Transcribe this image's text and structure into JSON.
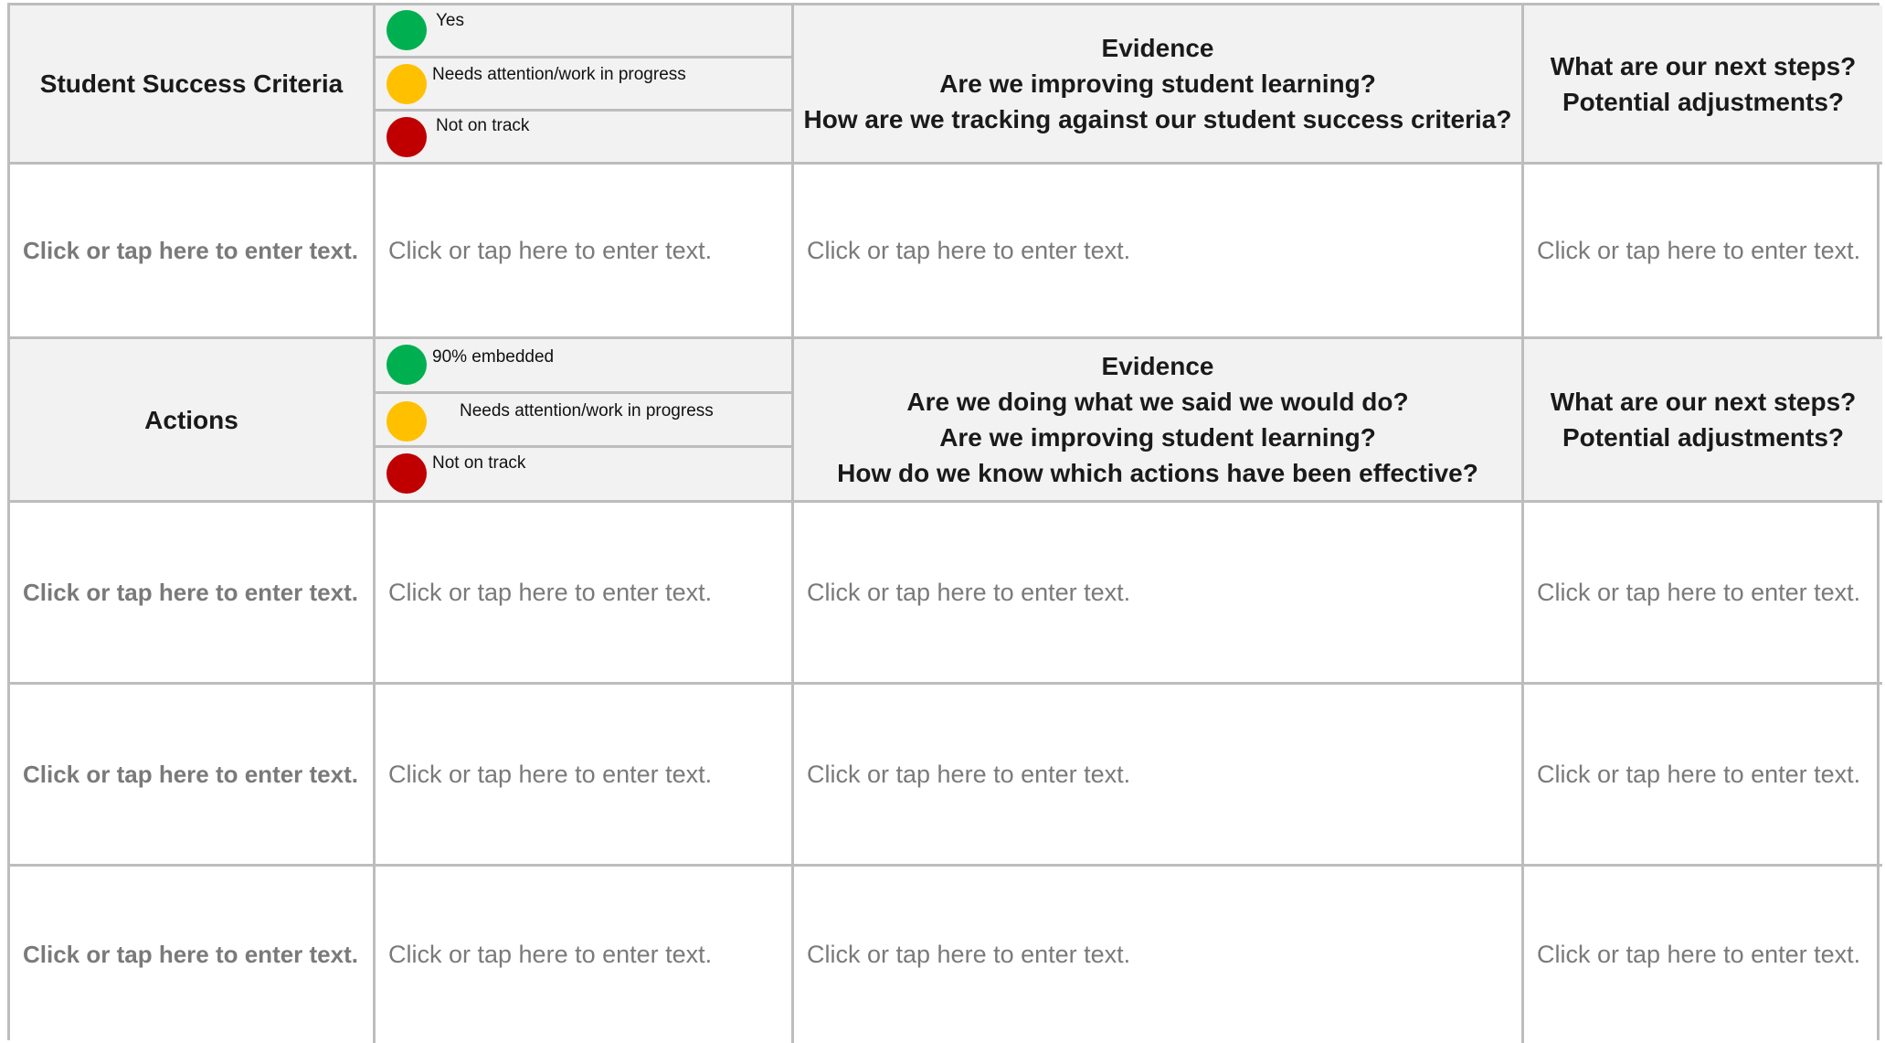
{
  "colors": {
    "green": "#00b050",
    "amber": "#ffc000",
    "red": "#c00000"
  },
  "section1": {
    "title": "Student Success Criteria",
    "legend": [
      {
        "label": "Yes",
        "color": "green"
      },
      {
        "label": "Needs attention/work in progress",
        "color": "amber"
      },
      {
        "label": "Not on track",
        "color": "red"
      }
    ],
    "evidence": [
      "Evidence",
      "Are we improving student learning?",
      "How are we tracking against our student success criteria?"
    ],
    "next_steps": [
      "What are our next steps?",
      "Potential adjustments?"
    ],
    "rows": [
      [
        "Click or tap here to enter text.",
        "Click or tap here to enter text.",
        "Click or tap here to enter text.",
        "Click or tap here to enter text."
      ]
    ]
  },
  "section2": {
    "title": "Actions",
    "legend": [
      {
        "label": "90% embedded",
        "color": "green"
      },
      {
        "label": "Needs attention/work in progress",
        "color": "amber"
      },
      {
        "label": "Not on track",
        "color": "red"
      }
    ],
    "evidence": [
      "Evidence",
      "Are we doing what we said we would do?",
      "Are we improving student learning?",
      "How do we know which actions have been effective?"
    ],
    "next_steps": [
      "What are our next steps?",
      "Potential adjustments?"
    ],
    "rows": [
      [
        "Click or tap here to enter text.",
        "Click or tap here to enter text.",
        "Click or tap here to enter text.",
        "Click or tap here to enter text."
      ],
      [
        "Click or tap here to enter text.",
        "Click or tap here to enter text.",
        "Click or tap here to enter text.",
        "Click or tap here to enter text."
      ],
      [
        "Click or tap here to enter text.",
        "Click or tap here to enter text.",
        "Click or tap here to enter text.",
        "Click or tap here to enter text."
      ]
    ]
  }
}
